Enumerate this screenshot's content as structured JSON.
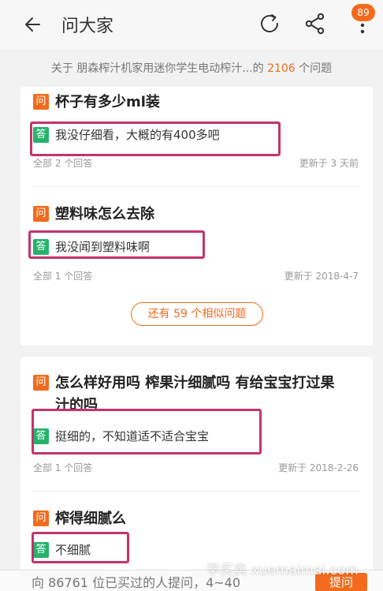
{
  "header": {
    "title": "问大家",
    "badge_count": "89"
  },
  "summary": {
    "prefix": "关于 朋森榨汁机家用迷你学生电动榨汁...的 ",
    "count": "2106",
    "suffix": " 个问题"
  },
  "labels": {
    "question_tag": "问",
    "answer_tag": "答"
  },
  "questions": [
    {
      "question": "杯子有多少ml装",
      "answer": "我没仔细看，大概的有400多吧",
      "answer_count": "全部 2 个回答",
      "updated": "更新于 3 天前"
    },
    {
      "question": "塑料味怎么去除",
      "answer": "我没闻到塑料味啊",
      "answer_count": "全部 1 个回答",
      "updated": "更新于 2018-4-7"
    },
    {
      "question_line1": "怎么样好用吗 榨果汁细腻吗 有给宝宝打过果",
      "question_line2": "汁的吗",
      "answer": "挺细的，不知道适不适合宝宝",
      "answer_count": "全部 1 个回答",
      "updated": "更新于 2018-2-26"
    },
    {
      "question": "榨得细腻么",
      "answer": "不细腻"
    }
  ],
  "similar_button": "还有 59 个相似问题",
  "bottom": {
    "prompt": "向 86761 位已买过的人提问，4~40",
    "ask_button": "提问"
  },
  "watermark": "学买卖 xuemaimai.com",
  "colors": {
    "accent": "#f26b1d",
    "answer_green": "#25b36b",
    "highlight_box": "#c4336c"
  }
}
